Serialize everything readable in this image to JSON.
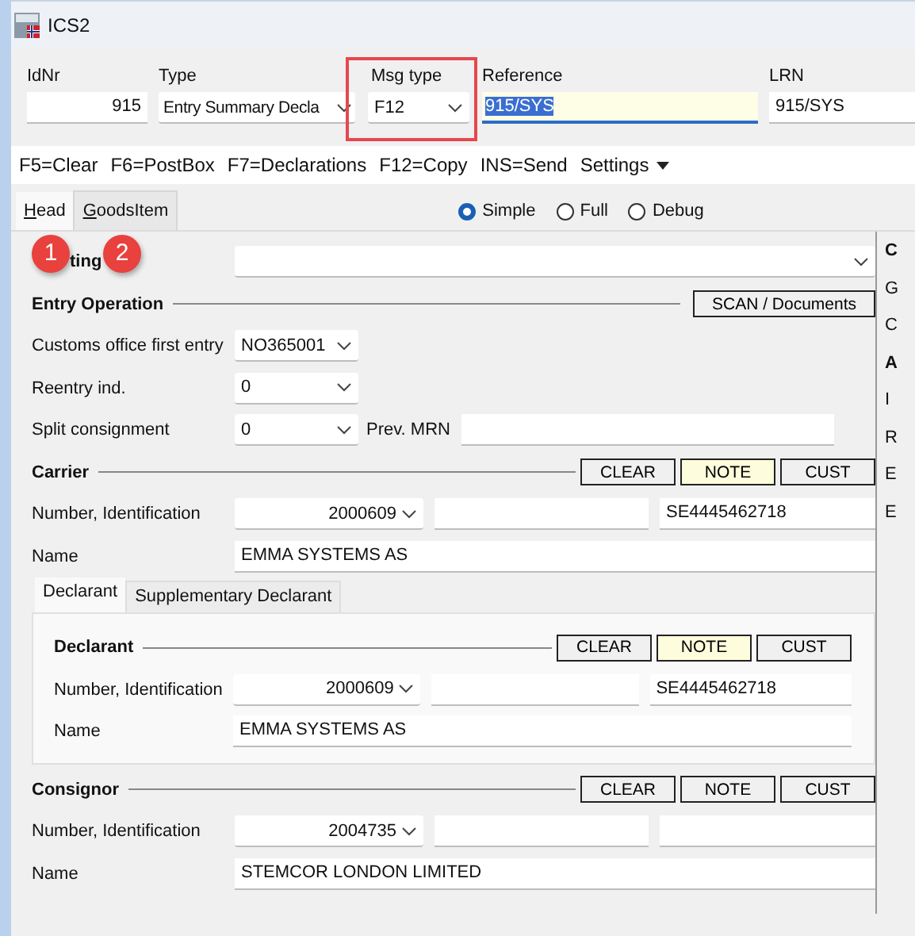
{
  "window": {
    "title": "ICS2"
  },
  "header_fields": [
    {
      "label": "IdNr",
      "value": "915",
      "kind": "number"
    },
    {
      "label": "Type",
      "value": "Entry Summary Decla",
      "kind": "dropdown"
    },
    {
      "label": "Msg type",
      "value": "F12",
      "kind": "dropdown"
    },
    {
      "label": "Reference",
      "value": "915/SYS",
      "kind": "focused"
    },
    {
      "label": "LRN",
      "value": "915/SYS",
      "kind": "text"
    }
  ],
  "toolbar": [
    {
      "label": "F5=Clear",
      "kind": "command"
    },
    {
      "label": "F6=PostBox",
      "kind": "command"
    },
    {
      "label": "F7=Declarations",
      "kind": "command"
    },
    {
      "label": "F12=Copy",
      "kind": "command"
    },
    {
      "label": "INS=Send",
      "kind": "command"
    },
    {
      "label": "Settings",
      "kind": "menu"
    }
  ],
  "tabs": [
    {
      "label": "Head",
      "selected": true
    },
    {
      "label": "GoodsItem",
      "selected": false
    }
  ],
  "view_modes": [
    {
      "label": "Simple",
      "selected": true
    },
    {
      "label": "Full",
      "selected": false
    },
    {
      "label": "Debug",
      "selected": false
    }
  ],
  "booking": {
    "label": "ting"
  },
  "entry_operation": {
    "title": "Entry Operation",
    "button": "SCAN / Documents",
    "rows": [
      {
        "label": "Customs office first entry",
        "value": "NO365001"
      },
      {
        "label": "Reentry ind.",
        "value": "0"
      },
      {
        "label": "Split consignment",
        "value": "0"
      }
    ],
    "prev_mrn": {
      "label": "Prev. MRN"
    }
  },
  "carrier": {
    "title": "Carrier",
    "buttons": [
      {
        "label": "CLEAR",
        "highlighted": false
      },
      {
        "label": "NOTE",
        "highlighted": true
      },
      {
        "label": "CUST",
        "highlighted": false
      }
    ],
    "number_label": "Number, Identification",
    "number": "2000609",
    "eori": "SE4445462718",
    "name_label": "Name",
    "name": "EMMA SYSTEMS AS"
  },
  "declarant_tabs": [
    {
      "label": "Declarant",
      "selected": true
    },
    {
      "label": "Supplementary Declarant",
      "selected": false
    }
  ],
  "declarant": {
    "title": "Declarant",
    "buttons": [
      {
        "label": "CLEAR",
        "highlighted": false
      },
      {
        "label": "NOTE",
        "highlighted": true
      },
      {
        "label": "CUST",
        "highlighted": false
      }
    ],
    "number_label": "Number, Identification",
    "number": "2000609",
    "eori": "SE4445462718",
    "name_label": "Name",
    "name": "EMMA SYSTEMS AS"
  },
  "consignor": {
    "title": "Consignor",
    "buttons": [
      {
        "label": "CLEAR",
        "highlighted": false
      },
      {
        "label": "NOTE",
        "highlighted": false
      },
      {
        "label": "CUST",
        "highlighted": false
      }
    ],
    "number_label": "Number, Identification",
    "number": "2004735",
    "name_label": "Name",
    "name": "STEMCOR LONDON LIMITED"
  },
  "side_panel": [
    {
      "text": "C",
      "bold": true
    },
    {
      "text": "G",
      "bold": false
    },
    {
      "text": "C",
      "bold": false
    },
    {
      "text": "A",
      "bold": true
    },
    {
      "text": "I",
      "bold": false
    },
    {
      "text": "R",
      "bold": false
    },
    {
      "text": "E",
      "bold": false
    },
    {
      "text": "E",
      "bold": false
    }
  ],
  "annotations": [
    {
      "kind": "badge",
      "text": "1"
    },
    {
      "kind": "badge",
      "text": "2"
    },
    {
      "kind": "frame"
    }
  ]
}
